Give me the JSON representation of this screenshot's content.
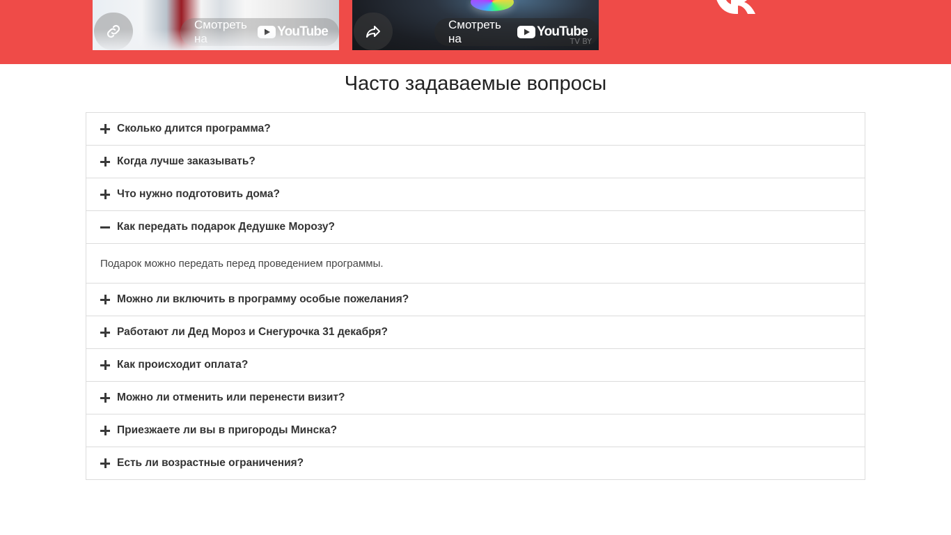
{
  "videos": [
    {
      "left_button_icon": "link-icon",
      "watch_label": "Смотреть на",
      "platform": "YouTube"
    },
    {
      "left_button_icon": "share-icon",
      "watch_label": "Смотреть на",
      "platform": "YouTube",
      "watermark": "TV BY"
    }
  ],
  "social": {
    "icon": "vk-logo-icon"
  },
  "colors": {
    "band": "#ef4b48",
    "border": "#dcdcdc",
    "text": "#333333"
  },
  "faq": {
    "title": "Часто задаваемые вопросы",
    "items": [
      {
        "question": "Сколько длится программа?",
        "expanded": false,
        "icon": "plus-icon"
      },
      {
        "question": "Когда лучше заказывать?",
        "expanded": false,
        "icon": "plus-icon"
      },
      {
        "question": "Что нужно подготовить дома?",
        "expanded": false,
        "icon": "plus-icon"
      },
      {
        "question": "Как передать подарок Дедушке Морозу?",
        "expanded": true,
        "icon": "minus-icon",
        "answer": "Подарок можно передать перед проведением программы."
      },
      {
        "question": "Можно ли включить в программу особые пожелания?",
        "expanded": false,
        "icon": "plus-icon"
      },
      {
        "question": "Работают ли Дед Мороз и Снегурочка 31 декабря?",
        "expanded": false,
        "icon": "plus-icon"
      },
      {
        "question": "Как происходит оплата?",
        "expanded": false,
        "icon": "plus-icon"
      },
      {
        "question": "Можно ли отменить или перенести визит?",
        "expanded": false,
        "icon": "plus-icon"
      },
      {
        "question": "Приезжаете ли вы в пригороды Минска?",
        "expanded": false,
        "icon": "plus-icon"
      },
      {
        "question": "Есть ли возрастные ограничения?",
        "expanded": false,
        "icon": "plus-icon"
      }
    ]
  }
}
